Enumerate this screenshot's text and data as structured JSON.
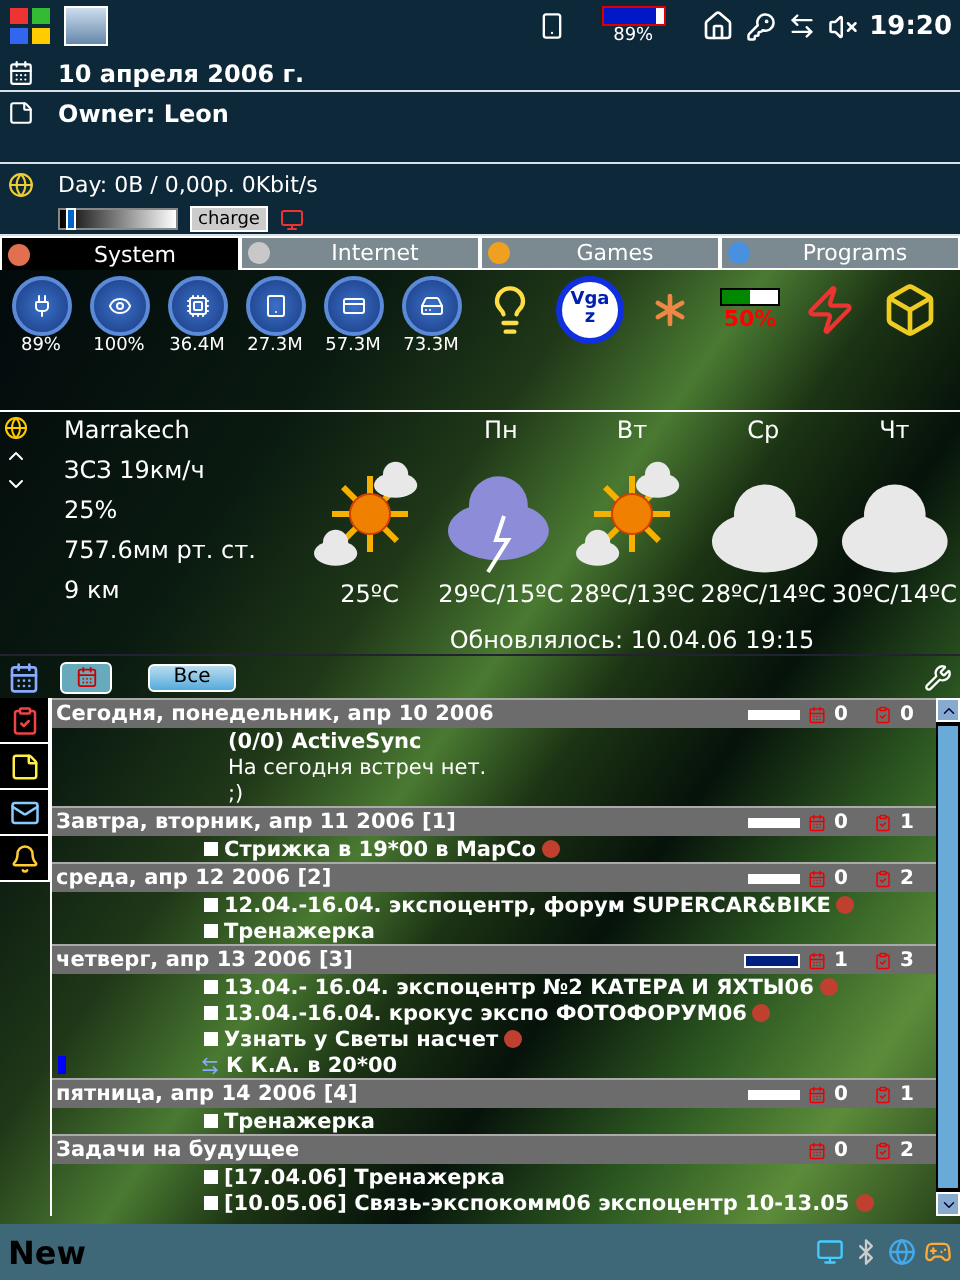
{
  "status_bar": {
    "battery": {
      "level": 0.89,
      "reading": "89%"
    },
    "time": "19:20"
  },
  "today": {
    "date": "10 апреля 2006 г.",
    "owner": "Owner: Leon",
    "traffic": "Day: 0B / 0,00р.  0Kbit/s",
    "slider": {
      "level": 0.05
    },
    "charge_button": "charge"
  },
  "tabs": [
    {
      "label": "System",
      "selected": true,
      "color": "#e07050"
    },
    {
      "label": "Internet",
      "selected": false,
      "color": "#c8c8c8"
    },
    {
      "label": "Games",
      "selected": false,
      "color": "#f0a020"
    },
    {
      "label": "Programs",
      "selected": false,
      "color": "#4a90e0"
    }
  ],
  "gauges": [
    {
      "kind": "power",
      "reading": "89%"
    },
    {
      "kind": "cpu",
      "reading": "100%"
    },
    {
      "kind": "memory",
      "reading": "36.4M"
    },
    {
      "kind": "storage",
      "reading": "27.3M"
    },
    {
      "kind": "card",
      "reading": "57.3M"
    },
    {
      "kind": "disk",
      "reading": "73.3M"
    }
  ],
  "apps": [
    {
      "kind": "pda"
    },
    {
      "kind": "vga",
      "label": "Vga",
      "badge": "z"
    },
    {
      "kind": "star"
    },
    {
      "kind": "meter",
      "level": 0.5,
      "reading": "50%"
    },
    {
      "kind": "flash"
    },
    {
      "kind": "cube"
    }
  ],
  "weather": {
    "city": "Marrakech",
    "wind": "ЗСЗ 19км/ч",
    "humidity": "25%",
    "pressure": "757.6мм рт. ст.",
    "visibility": "9 км",
    "days": [
      {
        "kind": "sun_cloud",
        "temp": "25ºC"
      },
      {
        "day": "Пн",
        "kind": "storm",
        "temp": "29ºC/15ºC"
      },
      {
        "day": "Вт",
        "kind": "sun_cloud",
        "temp": "28ºC/13ºC"
      },
      {
        "day": "Ср",
        "kind": "cloud",
        "temp": "28ºC/14ºC"
      },
      {
        "day": "Чт",
        "kind": "cloud",
        "temp": "30ºC/14ºC"
      }
    ],
    "updated": "Обновлялось: 10.04.06 19:15"
  },
  "calendar": {
    "filter_button": "Все",
    "groups": [
      {
        "title": "Сегодня, понедельник, апр 10 2006",
        "bar": {
          "busy": false
        },
        "appointments": "0",
        "tasks": "0",
        "entries": [
          {
            "kind": "sync",
            "text": "(0/0) ActiveSync"
          },
          {
            "kind": "note",
            "text": "На сегодня встреч нет."
          },
          {
            "kind": "note",
            "text": ";)"
          }
        ]
      },
      {
        "title": "Завтра, вторник, апр 11 2006 [1]",
        "bar": {
          "busy": false
        },
        "appointments": "0",
        "tasks": "1",
        "entries": [
          {
            "kind": "task",
            "checked": false,
            "important": true,
            "text": "Стрижка в 19*00 в МарСо"
          }
        ]
      },
      {
        "title": "среда, апр 12 2006 [2]",
        "bar": {
          "busy": false
        },
        "appointments": "0",
        "tasks": "2",
        "entries": [
          {
            "kind": "task",
            "checked": false,
            "important": true,
            "text": "12.04.-16.04. экспоцентр, форум SUPERCAR&BIKE"
          },
          {
            "kind": "task",
            "checked": false,
            "important": false,
            "text": "Тренажерка"
          }
        ]
      },
      {
        "title": "четверг, апр 13 2006 [3]",
        "bar": {
          "busy": true
        },
        "appointments": "1",
        "tasks": "3",
        "entries": [
          {
            "kind": "task",
            "checked": false,
            "important": true,
            "text": "13.04.- 16.04. экспоцентр №2 КАТЕРА И ЯХТЫ06"
          },
          {
            "kind": "task",
            "checked": false,
            "important": true,
            "text": "13.04.-16.04. крокус экспо ФОТОФОРУМ06"
          },
          {
            "kind": "task",
            "checked": false,
            "important": true,
            "text": "Узнать у Светы насчет"
          },
          {
            "kind": "appointment",
            "text": "К К.А. в 20*00"
          }
        ]
      },
      {
        "title": "пятница, апр 14 2006 [4]",
        "bar": {
          "busy": false
        },
        "appointments": "0",
        "tasks": "1",
        "entries": [
          {
            "kind": "task",
            "checked": false,
            "important": false,
            "text": "Тренажерка"
          }
        ]
      },
      {
        "title": "Задачи на будущее",
        "appointments": "0",
        "tasks": "2",
        "entries": [
          {
            "kind": "task",
            "checked": false,
            "important": false,
            "text": "[17.04.06] Тренажерка"
          },
          {
            "kind": "task",
            "checked": false,
            "important": true,
            "text": "[10.05.06] Связь-экспокомм06 экспоцентр 10-13.05"
          }
        ]
      }
    ]
  },
  "soft_key": "New"
}
